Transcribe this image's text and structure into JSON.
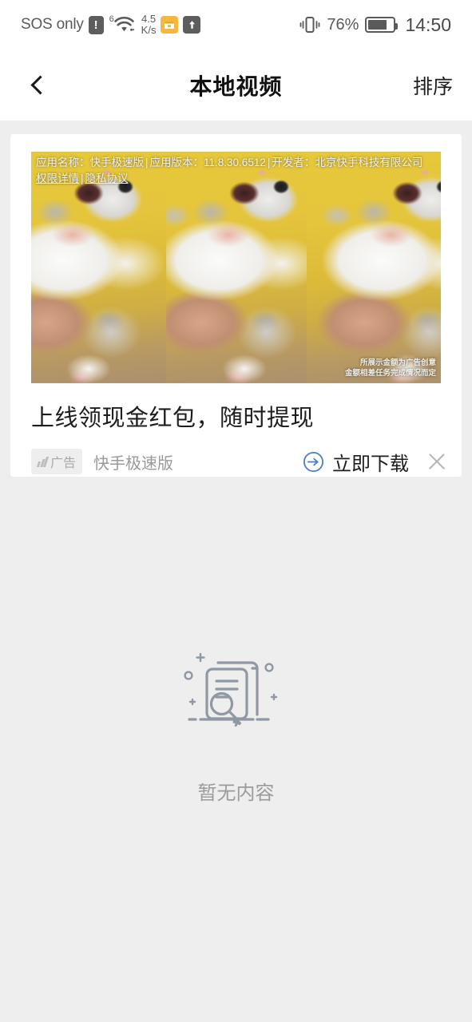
{
  "statusbar": {
    "carrier": "SOS only",
    "warning_icon": "!",
    "wifi_superscript": "6",
    "network_speed_value": "4.5",
    "network_speed_unit": "K/s",
    "battery_percent": "76%",
    "battery_level": 76,
    "clock": "14:50",
    "icons": [
      "sim-warning-icon",
      "wifi-icon",
      "folder-icon",
      "upload-icon",
      "vibrate-icon",
      "battery-icon"
    ]
  },
  "header": {
    "back_icon": "chevron-left-icon",
    "title": "本地视频",
    "sort_label": "排序"
  },
  "ad": {
    "legal": {
      "app_name_label": "应用名称：",
      "app_name": "快手极速版",
      "app_version_label": "应用版本：",
      "app_version": "11.8.30.6512",
      "developer_label": "开发者：",
      "developer": "北京快手科技有限公司",
      "permissions_link": "权限详情",
      "separator": "|",
      "privacy_link": "隐私协议"
    },
    "disclaimer_line1": "所展示金额为广告创意",
    "disclaimer_line2": "金额相差任务完成情况而定",
    "title": "上线领现金红包，随时提现",
    "badge_label": "广告",
    "source": "快手极速版",
    "download_label": "立即下载",
    "download_icon": "arrow-right-circle-icon",
    "close_icon": "close-icon",
    "accent_color": "#4a7ec7"
  },
  "empty_state": {
    "icon": "document-search-icon",
    "label": "暂无内容"
  },
  "theme": {
    "page_background": "#eeeeee",
    "card_background": "#ffffff",
    "title_color": "#111111",
    "muted_text": "#9b9b9b"
  }
}
